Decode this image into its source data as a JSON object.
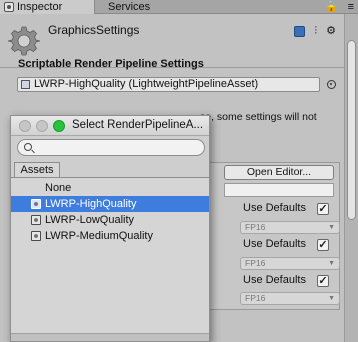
{
  "tabs": {
    "inspector": "Inspector",
    "services": "Services",
    "tools": [
      "🔒",
      "≡"
    ]
  },
  "header": {
    "title": "GraphicsSettings",
    "icons": [
      "book-icon",
      "settings-sliders-icon",
      "gear-icon"
    ]
  },
  "srp": {
    "section_title": "Scriptable Render Pipeline Settings",
    "asset_value": "LWRP-HighQuality (LightweightPipelineAsset)",
    "warning_text": "se, some settings will not"
  },
  "settings": {
    "open_editor_label": "Open Editor...",
    "rows": [
      {
        "label": "Use Defaults",
        "checked": true,
        "check_mark": "✓",
        "select_value": "FP16"
      },
      {
        "label": "Use Defaults",
        "checked": true,
        "check_mark": "✓",
        "select_value": "FP16"
      },
      {
        "label": "Use Defaults",
        "checked": true,
        "check_mark": "✓",
        "select_value": "FP16"
      }
    ]
  },
  "popup": {
    "title": "Select RenderPipelineA...",
    "search_value": "",
    "tab_label": "Assets",
    "items": [
      {
        "label": "None",
        "selected": false
      },
      {
        "label": "LWRP-HighQuality",
        "selected": true
      },
      {
        "label": "LWRP-LowQuality",
        "selected": false
      },
      {
        "label": "LWRP-MediumQuality",
        "selected": false
      }
    ]
  },
  "colors": {
    "selection": "#3e7ddd",
    "panel_bg": "#c2c2c2",
    "maximize_button": "#29c33f"
  }
}
